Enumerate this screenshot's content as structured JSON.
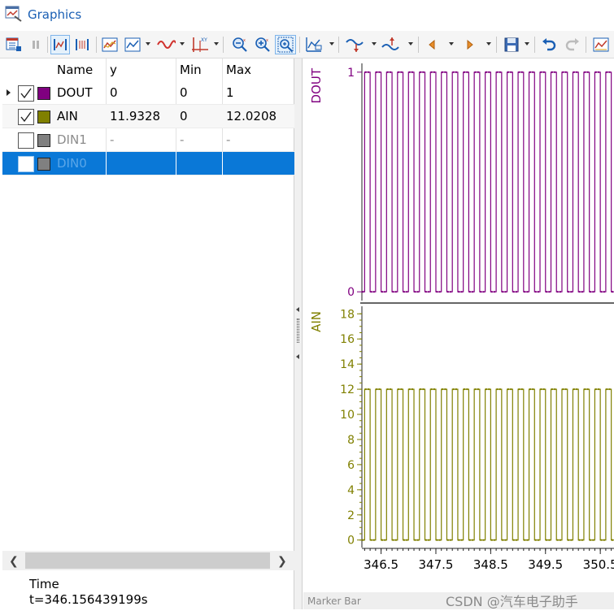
{
  "window": {
    "title": "Graphics"
  },
  "grid": {
    "columns": [
      "Name",
      "y",
      "Min",
      "Max"
    ],
    "rows": [
      {
        "name": "DOUT",
        "y": "0",
        "min": "0",
        "max": "1",
        "checked": true,
        "color": "#800080",
        "state": "normal"
      },
      {
        "name": "AIN",
        "y": "11.9328",
        "min": "0",
        "max": "12.0208",
        "checked": true,
        "color": "#808000",
        "state": "normal"
      },
      {
        "name": "DIN1",
        "y": "-",
        "min": "-",
        "max": "-",
        "checked": false,
        "color": "#808080",
        "state": "disabled"
      },
      {
        "name": "DIN0",
        "y": "",
        "min": "",
        "max": "",
        "checked": false,
        "color": "#808080",
        "state": "selected"
      }
    ]
  },
  "status": {
    "time_label": "Time",
    "time_value": "t=346.156439199s"
  },
  "marker_bar": {
    "label": "Marker Bar"
  },
  "watermark": "CSDN @汽车电子助手",
  "plots": {
    "x_ticks": [
      "346.5",
      "347.5",
      "348.5",
      "349.5",
      "350.5"
    ],
    "x_tick_values": [
      346.5,
      347.5,
      348.5,
      349.5,
      350.5
    ],
    "x_range": [
      346.15,
      350.75
    ],
    "signals": [
      {
        "name": "DOUT",
        "color": "#800080",
        "y_ticks": [
          "1",
          "0"
        ],
        "y_tick_values": [
          1,
          0
        ],
        "y_range": [
          -0.04,
          1.04
        ],
        "low": 0,
        "high": 1
      },
      {
        "name": "AIN",
        "color": "#808000",
        "y_ticks": [
          "18",
          "16",
          "14",
          "12",
          "10",
          "8",
          "6",
          "4",
          "2",
          "0"
        ],
        "y_tick_values": [
          18,
          16,
          14,
          12,
          10,
          8,
          6,
          4,
          2,
          0
        ],
        "y_range": [
          -0.6,
          18.6
        ],
        "low": 0,
        "high": 12
      }
    ],
    "period": 0.2,
    "start_phase": 0.05
  },
  "colors": {
    "accent": "#1a5fb4",
    "selection": "#0a78d7"
  }
}
